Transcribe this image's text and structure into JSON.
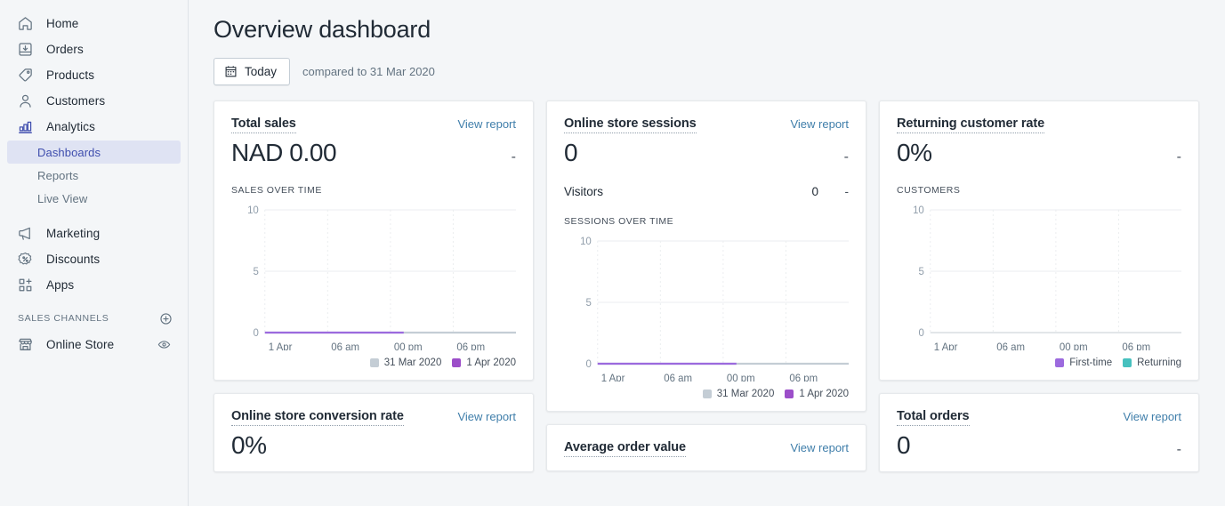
{
  "sidebar": {
    "items": [
      {
        "label": "Home",
        "icon": "home-icon"
      },
      {
        "label": "Orders",
        "icon": "orders-icon"
      },
      {
        "label": "Products",
        "icon": "products-tag-icon"
      },
      {
        "label": "Customers",
        "icon": "customers-person-icon"
      },
      {
        "label": "Analytics",
        "icon": "analytics-bar-chart-icon"
      }
    ],
    "analytics_subitems": [
      {
        "label": "Dashboards",
        "selected": true
      },
      {
        "label": "Reports",
        "selected": false
      },
      {
        "label": "Live View",
        "selected": false
      }
    ],
    "items_bottom": [
      {
        "label": "Marketing",
        "icon": "marketing-megaphone-icon"
      },
      {
        "label": "Discounts",
        "icon": "discounts-percent-icon"
      },
      {
        "label": "Apps",
        "icon": "apps-grid-plus-icon"
      }
    ],
    "sales_channels": {
      "title": "SALES CHANNELS",
      "add_icon": "plus-circle-icon",
      "channels": [
        {
          "label": "Online Store",
          "icon": "online-store-icon",
          "action_icon": "eye-icon"
        }
      ]
    },
    "accent_color": "#3f4eae",
    "selected_bg": "#dfe3f3"
  },
  "header": {
    "title": "Overview dashboard",
    "date_button": {
      "label": "Today",
      "icon": "calendar-icon"
    },
    "compared_to": "compared to 31 Mar 2020"
  },
  "colors": {
    "current_series": "#9c6ade",
    "previous_series": "#c4cdd5",
    "returning_series": "#47c1bf",
    "link": "#3f7eaa",
    "grid": "#ebeef0",
    "axis_text": "#919eab"
  },
  "legends": {
    "dates": [
      {
        "label": "31 Mar 2020",
        "color": "#c4cdd5"
      },
      {
        "label": "1 Apr 2020",
        "color": "#9c4ec9"
      }
    ],
    "customers": [
      {
        "label": "First-time",
        "color": "#9c6ade"
      },
      {
        "label": "Returning",
        "color": "#47c1bf"
      }
    ]
  },
  "cards": {
    "total_sales": {
      "title": "Total sales",
      "view_report": "View report",
      "value": "NAD 0.00",
      "delta": "-",
      "chart_label": "SALES OVER TIME"
    },
    "online_store_sessions": {
      "title": "Online store sessions",
      "view_report": "View report",
      "value": "0",
      "delta": "-",
      "sub_metric": {
        "label": "Visitors",
        "value": "0",
        "delta": "-"
      },
      "chart_label": "SESSIONS OVER TIME"
    },
    "returning_customer_rate": {
      "title": "Returning customer rate",
      "value": "0%",
      "delta": "-",
      "chart_label": "CUSTOMERS"
    },
    "online_store_conversion_rate": {
      "title": "Online store conversion rate",
      "view_report": "View report",
      "value": "0%"
    },
    "average_order_value": {
      "title": "Average order value",
      "view_report": "View report"
    },
    "total_orders": {
      "title": "Total orders",
      "view_report": "View report",
      "value": "0",
      "delta": "-"
    }
  },
  "chart_data": [
    {
      "id": "sales_over_time",
      "type": "line",
      "title": "Sales over time",
      "xlabel": "",
      "ylabel": "",
      "x": [
        "1 Apr",
        "06 am",
        "00 pm",
        "06 pm"
      ],
      "xticks": [
        "1 Apr",
        "06 am",
        "00 pm",
        "06 pm"
      ],
      "yticks": [
        0,
        5,
        10
      ],
      "ylim": [
        0,
        10
      ],
      "grid": true,
      "legend_position": "bottom-right",
      "series": [
        {
          "name": "31 Mar 2020",
          "color": "#c4cdd5",
          "values": [
            0,
            0,
            0,
            0,
            0
          ]
        },
        {
          "name": "1 Apr 2020",
          "color": "#9c6ade",
          "values": [
            0,
            0,
            0
          ],
          "partial_to": 0.55
        }
      ]
    },
    {
      "id": "sessions_over_time",
      "type": "line",
      "title": "Sessions over time",
      "xlabel": "",
      "ylabel": "",
      "x": [
        "1 Apr",
        "06 am",
        "00 pm",
        "06 pm"
      ],
      "xticks": [
        "1 Apr",
        "06 am",
        "00 pm",
        "06 pm"
      ],
      "yticks": [
        0,
        5,
        10
      ],
      "ylim": [
        0,
        10
      ],
      "grid": true,
      "legend_position": "bottom-right",
      "series": [
        {
          "name": "31 Mar 2020",
          "color": "#c4cdd5",
          "values": [
            0,
            0,
            0,
            0,
            0
          ]
        },
        {
          "name": "1 Apr 2020",
          "color": "#9c6ade",
          "values": [
            0,
            0,
            0
          ],
          "partial_to": 0.55
        }
      ]
    },
    {
      "id": "customers",
      "type": "line",
      "title": "Customers",
      "xlabel": "",
      "ylabel": "",
      "x": [
        "1 Apr",
        "06 am",
        "00 pm",
        "06 pm"
      ],
      "xticks": [
        "1 Apr",
        "06 am",
        "00 pm",
        "06 pm"
      ],
      "yticks": [
        0,
        5,
        10
      ],
      "ylim": [
        0,
        10
      ],
      "grid": true,
      "legend_position": "bottom-right",
      "series": [
        {
          "name": "First-time",
          "color": "#9c6ade",
          "values": [
            0,
            0,
            0,
            0,
            0
          ]
        },
        {
          "name": "Returning",
          "color": "#47c1bf",
          "values": [
            0,
            0,
            0,
            0,
            0
          ]
        }
      ]
    }
  ]
}
